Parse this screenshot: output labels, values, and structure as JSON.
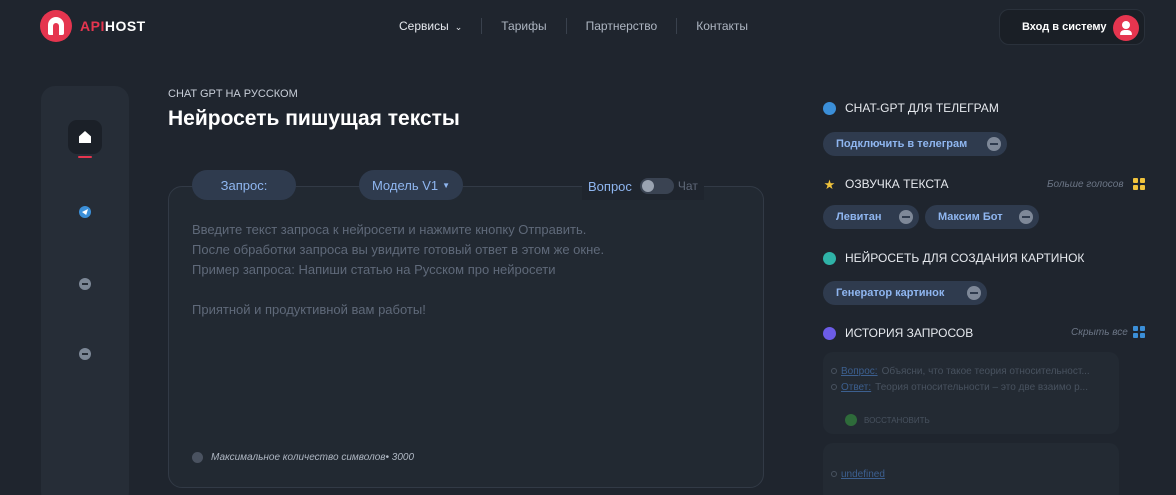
{
  "header": {
    "logo": {
      "part1": "API",
      "part2": "HOST"
    },
    "nav": [
      {
        "label": "Сервисы"
      },
      {
        "label": "Тарифы"
      },
      {
        "label": "Партнерство"
      },
      {
        "label": "Контакты"
      }
    ],
    "login_label": "Вход в систему"
  },
  "sidebar": {
    "items": [
      {
        "icon": "home-icon",
        "active": true
      },
      {
        "icon": "telegram-icon"
      },
      {
        "icon": "chat-icon"
      },
      {
        "icon": "message-icon"
      }
    ]
  },
  "main": {
    "subtitle": "CHAT GPT НА РУССКОМ",
    "title": "Нейросеть пишущая тексты",
    "request_label": "Запрос:",
    "model_label": "Модель V1",
    "mode_question": "Вопрос",
    "mode_chat": "Чат",
    "placeholder_lines": [
      "Введите текст запроса к нейросети и нажмите кнопку Отправить.",
      "После обработки запроса вы увидите готовый ответ в этом же окне.",
      "Пример запроса: Напиши статью на Русском про нейросети",
      "Приятной и продуктивной вам работы!"
    ],
    "limit_text": "Максимальное количество символов• 3000"
  },
  "right_panel": {
    "telegram": {
      "heading": "CHAT-GPT ДЛЯ ТЕЛЕГРАМ",
      "chip": "Подключить в телеграм"
    },
    "voice": {
      "heading": "ОЗВУЧКА ТЕКСТА",
      "more": "Больше голосов",
      "chips": [
        "Левитан",
        "Максим Бот"
      ]
    },
    "images": {
      "heading": "НЕЙРОСЕТЬ ДЛЯ СОЗДАНИЯ КАРТИНОК",
      "chip": "Генератор картинок"
    },
    "history": {
      "heading": "ИСТОРИЯ ЗАПРОСОВ",
      "hide": "Скрыть все",
      "entries": [
        {
          "question_label": "Вопрос:",
          "question": "Объясни, что такое теория относительност...",
          "answer_label": "Ответ:",
          "answer": "Теория относительности – это две взаимо р...",
          "restore": "восстановить"
        },
        {
          "question_label": "undefined"
        }
      ]
    }
  },
  "colors": {
    "background": "#1f252e",
    "accent": "#e5354f",
    "link": "#8fb6f0",
    "chip_bg": "#2f3b4e"
  }
}
